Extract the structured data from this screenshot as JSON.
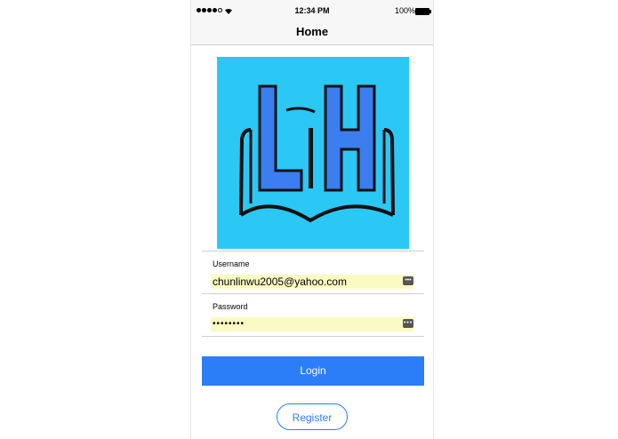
{
  "status_bar": {
    "time": "12:34 PM",
    "battery_percent": "100%",
    "signal_bars": 4,
    "signal_total": 5
  },
  "nav": {
    "title": "Home"
  },
  "logo": {
    "text": "LiH",
    "background": "#2bc8f6",
    "letter_color": "#3a7ef0"
  },
  "form": {
    "username_label": "Username",
    "username_value": "chunlinwu2005@yahoo.com",
    "password_label": "Password",
    "password_value": "••••••••",
    "key_icon": "key-icon"
  },
  "buttons": {
    "login_label": "Login",
    "register_label": "Register",
    "accent_color": "#2b7ef7"
  }
}
